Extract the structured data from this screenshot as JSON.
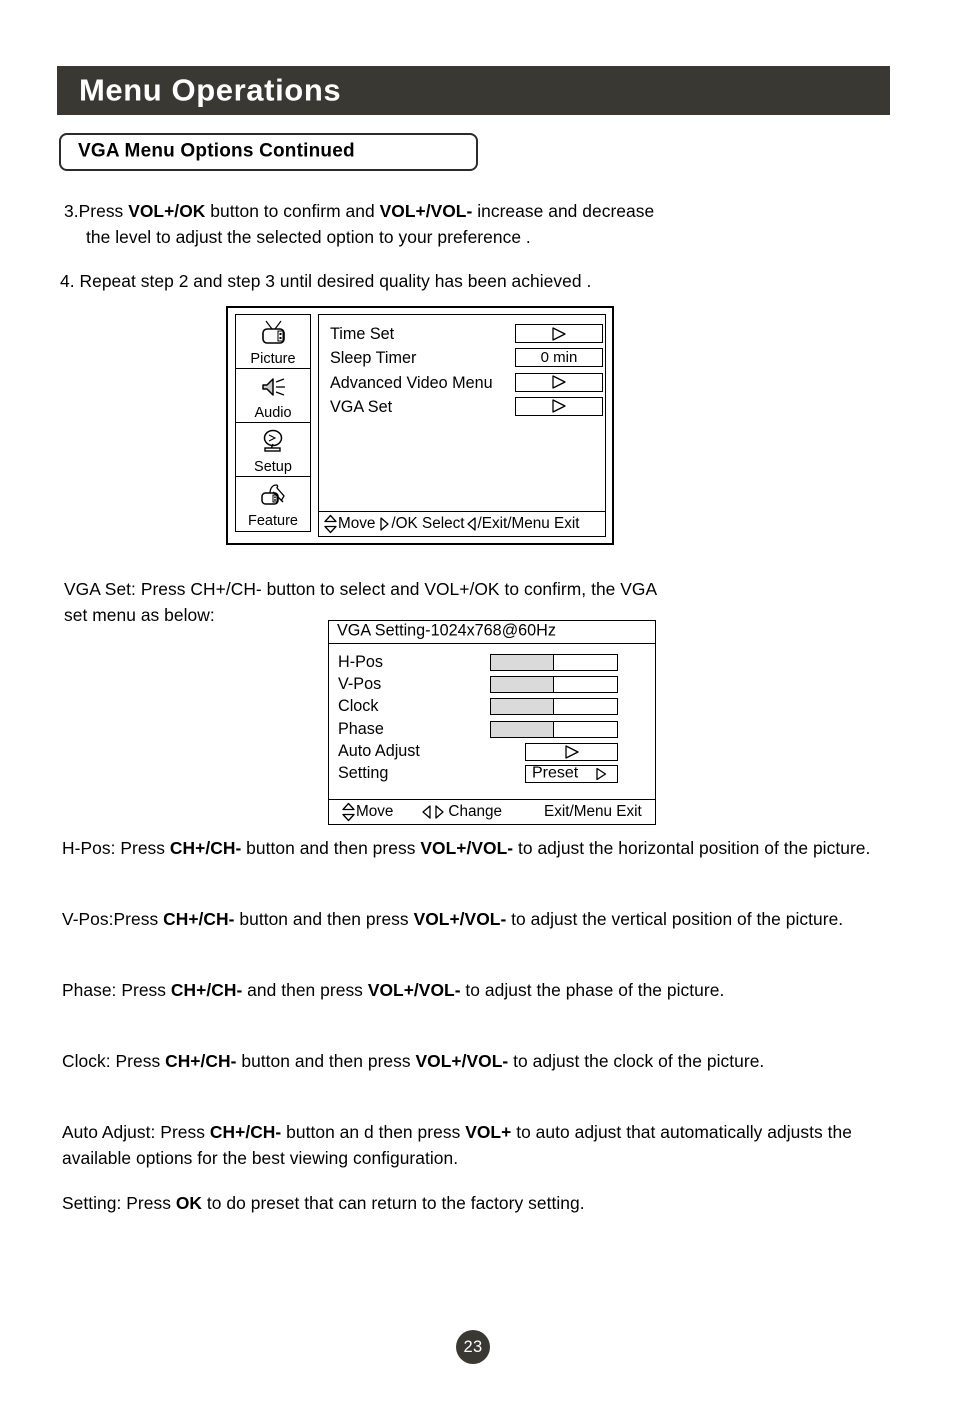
{
  "header": {
    "title": "Menu Operations",
    "bar_color": "#393833"
  },
  "section": {
    "label": "VGA Menu Options Continued"
  },
  "steps": {
    "step3_line1_pre": "3.Press ",
    "step3_bold1": "VOL+/OK",
    "step3_mid": " button to confirm and ",
    "step3_bold2": "VOL+/VOL-",
    "step3_post": " increase and decrease",
    "step3_line2": "the level to adjust the selected option to your preference .",
    "step4": "4. Repeat step 2 and step 3 until desired quality has been achieved ."
  },
  "osd_main": {
    "sidebar": [
      {
        "label": "Picture",
        "icon": "tv-icon"
      },
      {
        "label": "Audio",
        "icon": "speaker-icon"
      },
      {
        "label": "Setup",
        "icon": "satellite-dish-icon"
      },
      {
        "label": "Feature",
        "icon": "hand-remote-icon"
      }
    ],
    "rows": [
      {
        "label": "Time Set",
        "value": "",
        "type": "arrow"
      },
      {
        "label": "Sleep Timer",
        "value": "0 min",
        "type": "text"
      },
      {
        "label": "Advanced Video Menu",
        "value": "",
        "type": "arrow"
      },
      {
        "label": "VGA Set",
        "value": "",
        "type": "arrow"
      }
    ],
    "footer": {
      "move": "Move",
      "ok_select": "/OK  Select",
      "exit": "/Exit/Menu Exit"
    }
  },
  "vga_intro": {
    "line1": "VGA Set: Press CH+/CH- button to select and VOL+/OK to confirm, the VGA",
    "line2": "set menu as below:"
  },
  "osd_vga": {
    "title": "VGA Setting-1024x768@60Hz",
    "rows": [
      {
        "label": "H-Pos",
        "type": "slider",
        "fill_percent": 50
      },
      {
        "label": "V-Pos",
        "type": "slider",
        "fill_percent": 50
      },
      {
        "label": "Clock",
        "type": "slider",
        "fill_percent": 50
      },
      {
        "label": "Phase",
        "type": "slider",
        "fill_percent": 50
      },
      {
        "label": "Auto Adjust",
        "type": "arrow_button",
        "value": ""
      },
      {
        "label": "Setting",
        "type": "arrow_button",
        "value": "Preset"
      }
    ],
    "footer": {
      "move": "Move",
      "change": "Change",
      "exit": "Exit/Menu Exit"
    }
  },
  "descriptions": {
    "hpos": {
      "pre": "H-Pos: Press ",
      "b1": "CH+/CH-",
      "mid": " button and then press ",
      "b2": "VOL+/VOL-",
      "post": " to adjust the horizontal position of the picture."
    },
    "vpos": {
      "pre": "V-Pos:Press ",
      "b1": "CH+/CH-",
      "mid": " button and then press ",
      "b2": "VOL+/VOL-",
      "post": " to adjust the vertical position of the picture."
    },
    "phase": {
      "pre": "Phase: Press ",
      "b1": "CH+/CH-",
      "mid": " and then press ",
      "b2": "VOL+/VOL-",
      "post": " to adjust the phase of the picture."
    },
    "clock": {
      "pre": "Clock: Press ",
      "b1": "CH+/CH-",
      "mid": " button and then press ",
      "b2": "VOL+/VOL-",
      "post": " to adjust the clock of the picture."
    },
    "auto_adjust": {
      "pre": "Auto Adjust: Press ",
      "b1": "CH+/CH-",
      "mid": " button an d then press ",
      "b2": "VOL+",
      "post": " to auto adjust that automatically adjusts the available options for the best viewing configuration."
    },
    "setting": {
      "pre": "Setting: Press ",
      "b1": "OK",
      "mid": " to do preset that can return to the factory setting.",
      "b2": "",
      "post": ""
    }
  },
  "footer": {
    "page_number": "23"
  }
}
